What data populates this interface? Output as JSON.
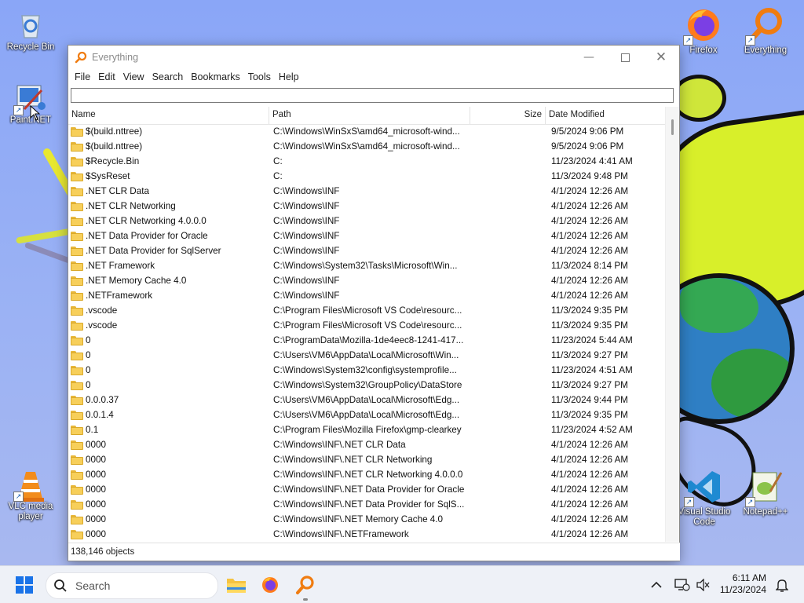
{
  "desktop": {
    "icons": [
      {
        "label": "Recycle Bin",
        "icon": "recycle-bin-icon"
      },
      {
        "label": "Paint.NET",
        "icon": "paintnet-icon"
      },
      {
        "label": "VLC media player",
        "icon": "vlc-icon"
      },
      {
        "label": "Firefox",
        "icon": "firefox-icon"
      },
      {
        "label": "Everything",
        "icon": "everything-icon"
      },
      {
        "label": "Visual Studio Code",
        "icon": "vscode-icon"
      },
      {
        "label": "Notepad++",
        "icon": "notepadpp-icon"
      }
    ]
  },
  "window": {
    "title": "Everything",
    "menu": [
      "File",
      "Edit",
      "View",
      "Search",
      "Bookmarks",
      "Tools",
      "Help"
    ],
    "search": {
      "value": "",
      "placeholder": ""
    },
    "columns": {
      "name": "Name",
      "path": "Path",
      "size": "Size",
      "date": "Date Modified"
    },
    "rows": [
      {
        "name": "$(build.nttree)",
        "path": "C:\\Windows\\WinSxS\\amd64_microsoft-wind...",
        "size": "",
        "date": "9/5/2024 9:06 PM"
      },
      {
        "name": "$(build.nttree)",
        "path": "C:\\Windows\\WinSxS\\amd64_microsoft-wind...",
        "size": "",
        "date": "9/5/2024 9:06 PM"
      },
      {
        "name": "$Recycle.Bin",
        "path": "C:",
        "size": "",
        "date": "11/23/2024 4:41 AM"
      },
      {
        "name": "$SysReset",
        "path": "C:",
        "size": "",
        "date": "11/3/2024 9:48 PM"
      },
      {
        "name": ".NET CLR Data",
        "path": "C:\\Windows\\INF",
        "size": "",
        "date": "4/1/2024 12:26 AM"
      },
      {
        "name": ".NET CLR Networking",
        "path": "C:\\Windows\\INF",
        "size": "",
        "date": "4/1/2024 12:26 AM"
      },
      {
        "name": ".NET CLR Networking 4.0.0.0",
        "path": "C:\\Windows\\INF",
        "size": "",
        "date": "4/1/2024 12:26 AM"
      },
      {
        "name": ".NET Data Provider for Oracle",
        "path": "C:\\Windows\\INF",
        "size": "",
        "date": "4/1/2024 12:26 AM"
      },
      {
        "name": ".NET Data Provider for SqlServer",
        "path": "C:\\Windows\\INF",
        "size": "",
        "date": "4/1/2024 12:26 AM"
      },
      {
        "name": ".NET Framework",
        "path": "C:\\Windows\\System32\\Tasks\\Microsoft\\Win...",
        "size": "",
        "date": "11/3/2024 8:14 PM"
      },
      {
        "name": ".NET Memory Cache 4.0",
        "path": "C:\\Windows\\INF",
        "size": "",
        "date": "4/1/2024 12:26 AM"
      },
      {
        "name": ".NETFramework",
        "path": "C:\\Windows\\INF",
        "size": "",
        "date": "4/1/2024 12:26 AM"
      },
      {
        "name": ".vscode",
        "path": "C:\\Program Files\\Microsoft VS Code\\resourc...",
        "size": "",
        "date": "11/3/2024 9:35 PM"
      },
      {
        "name": ".vscode",
        "path": "C:\\Program Files\\Microsoft VS Code\\resourc...",
        "size": "",
        "date": "11/3/2024 9:35 PM"
      },
      {
        "name": "0",
        "path": "C:\\ProgramData\\Mozilla-1de4eec8-1241-417...",
        "size": "",
        "date": "11/23/2024 5:44 AM"
      },
      {
        "name": "0",
        "path": "C:\\Users\\VM6\\AppData\\Local\\Microsoft\\Win...",
        "size": "",
        "date": "11/3/2024 9:27 PM"
      },
      {
        "name": "0",
        "path": "C:\\Windows\\System32\\config\\systemprofile...",
        "size": "",
        "date": "11/23/2024 4:51 AM"
      },
      {
        "name": "0",
        "path": "C:\\Windows\\System32\\GroupPolicy\\DataStore",
        "size": "",
        "date": "11/3/2024 9:27 PM"
      },
      {
        "name": "0.0.0.37",
        "path": "C:\\Users\\VM6\\AppData\\Local\\Microsoft\\Edg...",
        "size": "",
        "date": "11/3/2024 9:44 PM"
      },
      {
        "name": "0.0.1.4",
        "path": "C:\\Users\\VM6\\AppData\\Local\\Microsoft\\Edg...",
        "size": "",
        "date": "11/3/2024 9:35 PM"
      },
      {
        "name": "0.1",
        "path": "C:\\Program Files\\Mozilla Firefox\\gmp-clearkey",
        "size": "",
        "date": "11/23/2024 4:52 AM"
      },
      {
        "name": "0000",
        "path": "C:\\Windows\\INF\\.NET CLR Data",
        "size": "",
        "date": "4/1/2024 12:26 AM"
      },
      {
        "name": "0000",
        "path": "C:\\Windows\\INF\\.NET CLR Networking",
        "size": "",
        "date": "4/1/2024 12:26 AM"
      },
      {
        "name": "0000",
        "path": "C:\\Windows\\INF\\.NET CLR Networking 4.0.0.0",
        "size": "",
        "date": "4/1/2024 12:26 AM"
      },
      {
        "name": "0000",
        "path": "C:\\Windows\\INF\\.NET Data Provider for Oracle",
        "size": "",
        "date": "4/1/2024 12:26 AM"
      },
      {
        "name": "0000",
        "path": "C:\\Windows\\INF\\.NET Data Provider for SqlS...",
        "size": "",
        "date": "4/1/2024 12:26 AM"
      },
      {
        "name": "0000",
        "path": "C:\\Windows\\INF\\.NET Memory Cache 4.0",
        "size": "",
        "date": "4/1/2024 12:26 AM"
      },
      {
        "name": "0000",
        "path": "C:\\Windows\\INF\\.NETFramework",
        "size": "",
        "date": "4/1/2024 12:26 AM"
      }
    ],
    "status": "138,146 objects"
  },
  "taskbar": {
    "search_label": "Search",
    "apps": [
      "file-explorer-icon",
      "firefox-icon",
      "everything-icon"
    ],
    "time": "6:11 AM",
    "date": "11/23/2024"
  },
  "colors": {
    "accent": "#1a73e8",
    "folder": "#f7cf5a",
    "taskbar": "#eef1f7"
  }
}
